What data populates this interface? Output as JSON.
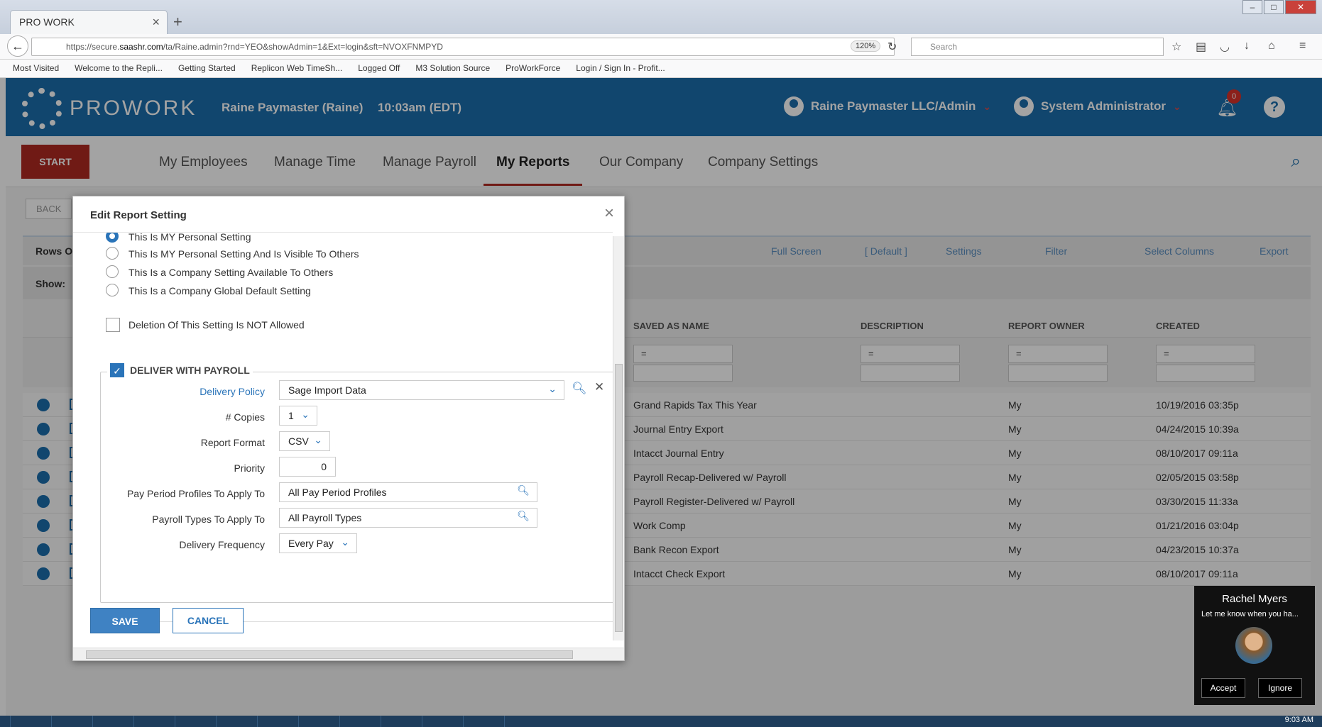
{
  "browser": {
    "tab_title": "PRO WORK",
    "url_prefix": "https://secure.",
    "url_domain": "saashr.com",
    "url_rest": "/ta/Raine.admin?rnd=YEO&showAdmin=1&Ext=login&sft=NVOXFNMPYD",
    "zoom": "120%",
    "search_placeholder": "Search",
    "bookmarks": [
      "Most Visited",
      "Welcome to the Repli...",
      "Getting Started",
      "Replicon Web TimeSh...",
      "Logged Off",
      "M3 Solution Source",
      "ProWorkForce",
      "Login / Sign In - Profit..."
    ]
  },
  "header": {
    "logo_text": "PROWORK",
    "company": "Raine Paymaster (Raine)",
    "time": "10:03am (EDT)",
    "account": "Raine Paymaster LLC/Admin",
    "user": "System Administrator",
    "notifications": "0",
    "help": "?"
  },
  "nav": {
    "start": "START",
    "items": [
      "My Employees",
      "Manage Time",
      "Manage Payroll",
      "My Reports",
      "Our Company",
      "Company Settings"
    ]
  },
  "background": {
    "back": "BACK",
    "rows_label": "Rows On",
    "show_label": "Show:",
    "toolbar": [
      "Full Screen",
      "[ Default ]",
      "Settings",
      "Filter",
      "Select Columns",
      "Export"
    ],
    "columns": [
      "SAVED AS NAME",
      "DESCRIPTION",
      "REPORT OWNER",
      "CREATED"
    ],
    "filter_op": "=",
    "rows": [
      {
        "name": "Grand Rapids Tax This Year",
        "owner": "My",
        "created": "10/19/2016 03:35p"
      },
      {
        "name": "Journal Entry Export",
        "owner": "My",
        "created": "04/24/2015 10:39a"
      },
      {
        "name": "Intacct Journal Entry",
        "owner": "My",
        "created": "08/10/2017 09:11a"
      },
      {
        "name": "Payroll Recap-Delivered w/ Payroll",
        "owner": "My",
        "created": "02/05/2015 03:58p"
      },
      {
        "name": "Payroll Register-Delivered w/ Payroll",
        "owner": "My",
        "created": "03/30/2015 11:33a"
      },
      {
        "name": "Work Comp",
        "owner": "My",
        "created": "01/21/2016 03:04p"
      },
      {
        "name": "Bank Recon Export",
        "owner": "My",
        "created": "04/23/2015 10:37a"
      },
      {
        "name": "Intacct Check Export",
        "owner": "My",
        "created": "08/10/2017 09:11a"
      }
    ]
  },
  "modal": {
    "title": "Edit Report Setting",
    "radios": [
      "This Is MY Personal Setting",
      "This Is MY Personal Setting And Is Visible To Others",
      "This Is a Company Setting Available To Others",
      "This Is a Company Global Default Setting"
    ],
    "deletion_label": "Deletion Of This Setting Is NOT Allowed",
    "deliver_label": "DELIVER WITH PAYROLL",
    "fields": {
      "delivery_policy_label": "Delivery Policy",
      "delivery_policy_value": "Sage Import Data",
      "copies_label": "# Copies",
      "copies_value": "1",
      "format_label": "Report Format",
      "format_value": "CSV",
      "priority_label": "Priority",
      "priority_value": "0",
      "pay_period_label": "Pay Period Profiles To Apply To",
      "pay_period_value": "All Pay Period Profiles",
      "payroll_types_label": "Payroll Types To Apply To",
      "payroll_types_value": "All Payroll Types",
      "frequency_label": "Delivery Frequency",
      "frequency_value": "Every Pay"
    },
    "save": "SAVE",
    "cancel": "CANCEL"
  },
  "chat": {
    "name": "Rachel Myers",
    "message": "Let me know when you ha...",
    "accept": "Accept",
    "ignore": "Ignore"
  },
  "taskbar": {
    "clock": "9:03 AM"
  },
  "colors": {
    "brand": "#1b6eac",
    "start": "#b02a22",
    "primary": "#3f82c3"
  }
}
